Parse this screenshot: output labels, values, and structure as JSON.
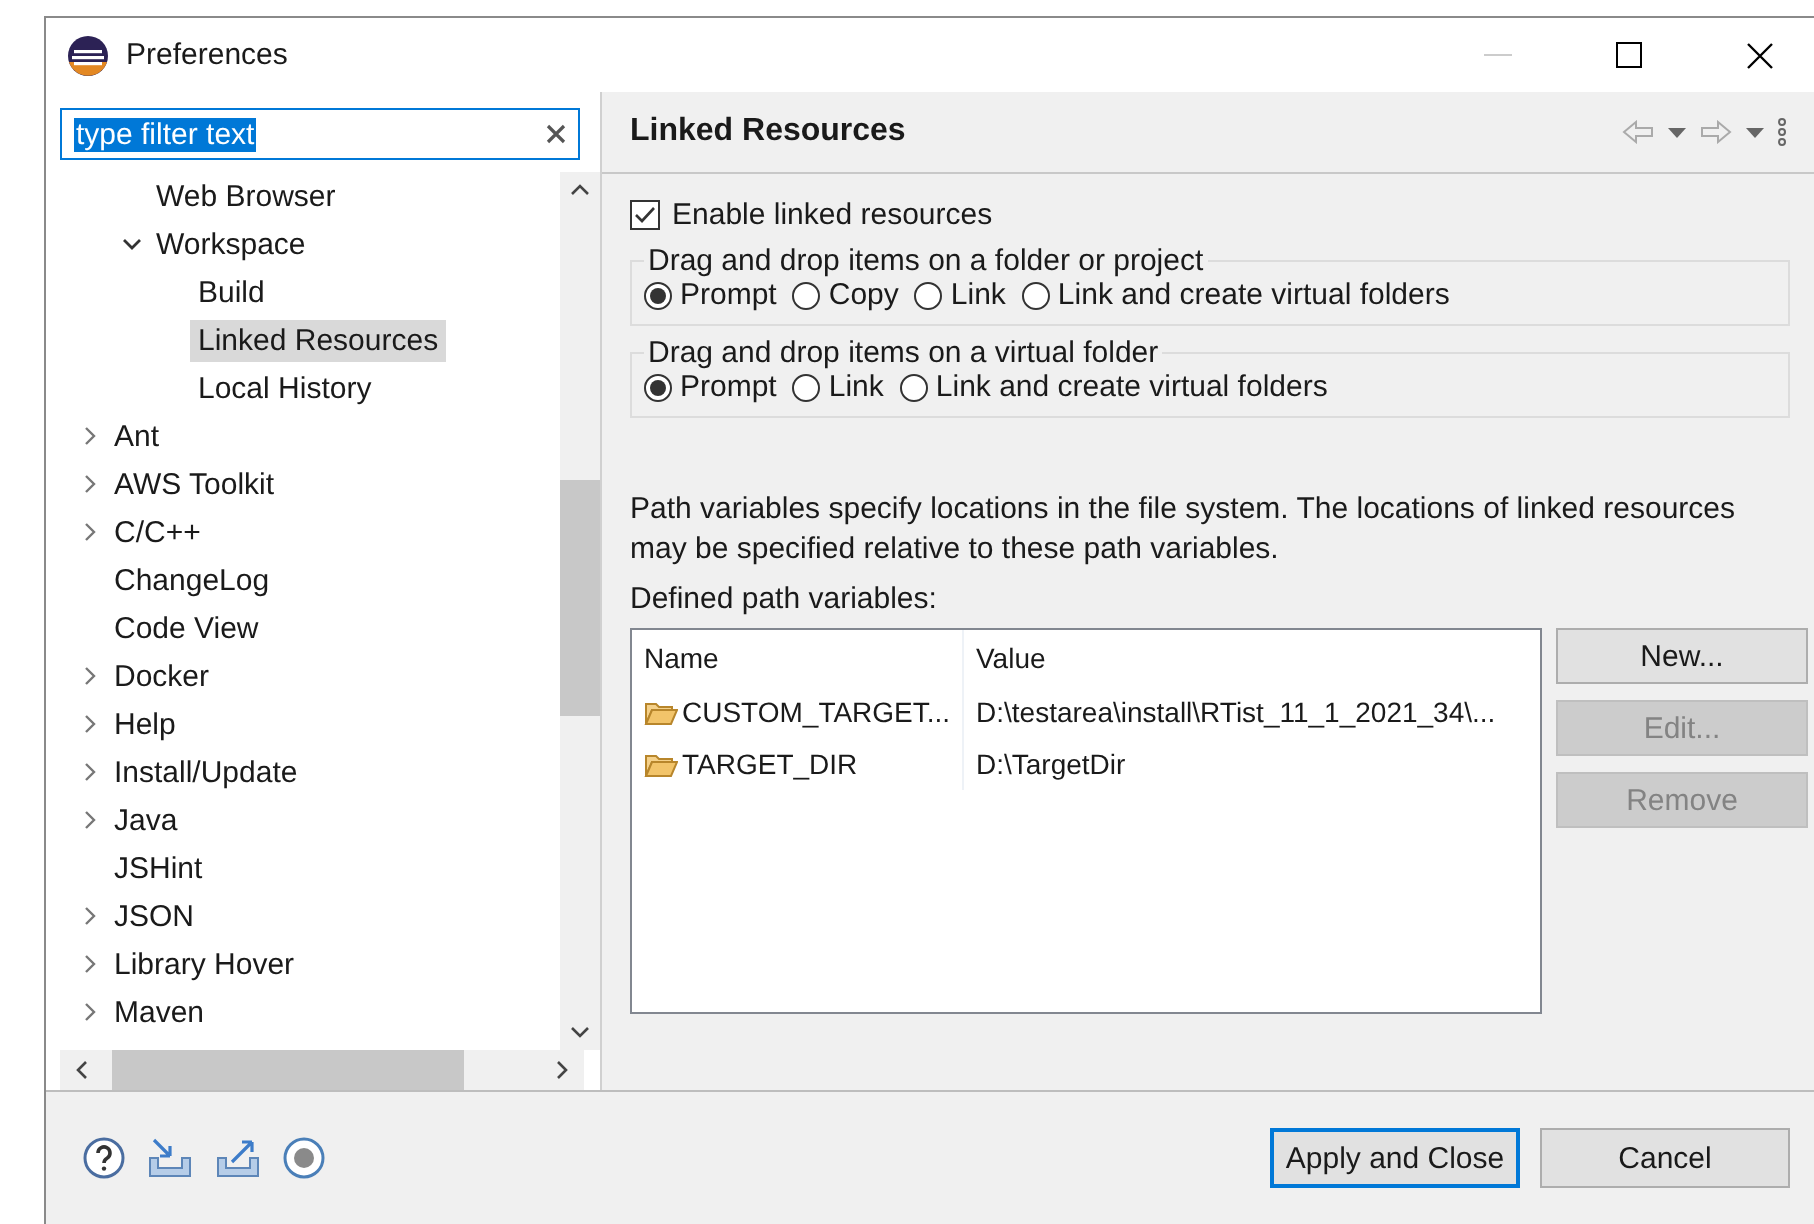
{
  "window": {
    "title": "Preferences"
  },
  "filter": {
    "value": "type filter text",
    "value_selected": true
  },
  "tree": {
    "continued_items": [
      {
        "label": "Web Browser",
        "selected": false
      },
      {
        "label": "Workspace",
        "selected": false,
        "expanded": true,
        "children": [
          {
            "label": "Build",
            "selected": false
          },
          {
            "label": "Linked Resources",
            "selected": true
          },
          {
            "label": "Local History",
            "selected": false
          }
        ]
      }
    ],
    "items": [
      {
        "label": "Ant",
        "selected": false,
        "expanded": false
      },
      {
        "label": "AWS Toolkit",
        "selected": false,
        "expanded": false
      },
      {
        "label": "C/C++",
        "selected": false,
        "expanded": false
      },
      {
        "label": "ChangeLog",
        "selected": false
      },
      {
        "label": "Code View",
        "selected": false
      },
      {
        "label": "Docker",
        "selected": false,
        "expanded": false
      },
      {
        "label": "Help",
        "selected": false,
        "expanded": false
      },
      {
        "label": "Install/Update",
        "selected": false,
        "expanded": false
      },
      {
        "label": "Java",
        "selected": false,
        "expanded": false
      },
      {
        "label": "JSHint",
        "selected": false
      },
      {
        "label": "JSON",
        "selected": false,
        "expanded": false
      },
      {
        "label": "Library Hover",
        "selected": false,
        "expanded": false
      },
      {
        "label": "Maven",
        "selected": false,
        "expanded": false
      }
    ]
  },
  "page": {
    "title": "Linked Resources",
    "enable": {
      "label": "Enable linked resources",
      "checked": true
    },
    "groups": [
      {
        "title": "Drag and drop items on a folder or project",
        "options": [
          {
            "label": "Prompt",
            "selected": true
          },
          {
            "label": "Copy",
            "selected": false
          },
          {
            "label": "Link",
            "selected": false
          },
          {
            "label": "Link and create virtual folders",
            "selected": false
          }
        ]
      },
      {
        "title": "Drag and drop items on a virtual folder",
        "options": [
          {
            "label": "Prompt",
            "selected": true
          },
          {
            "label": "Link",
            "selected": false
          },
          {
            "label": "Link and create virtual folders",
            "selected": false
          }
        ]
      }
    ],
    "description": "Path variables specify locations in the file system. The locations of linked resources may be specified relative to these path variables.",
    "table_label": "Defined path variables:",
    "table": {
      "columns": [
        "Name",
        "Value"
      ],
      "rows": [
        {
          "name": "CUSTOM_TARGET...",
          "value": "D:\\testarea\\install\\RTist_11_1_2021_34\\..."
        },
        {
          "name": "TARGET_DIR",
          "value": "D:\\TargetDir"
        }
      ]
    },
    "buttons": [
      {
        "label": "New...",
        "disabled": false
      },
      {
        "label": "Edit...",
        "disabled": true
      },
      {
        "label": "Remove",
        "disabled": true
      }
    ]
  },
  "dialog_buttons": [
    {
      "label": "Apply and Close",
      "default": true
    },
    {
      "label": "Cancel",
      "default": false
    }
  ]
}
